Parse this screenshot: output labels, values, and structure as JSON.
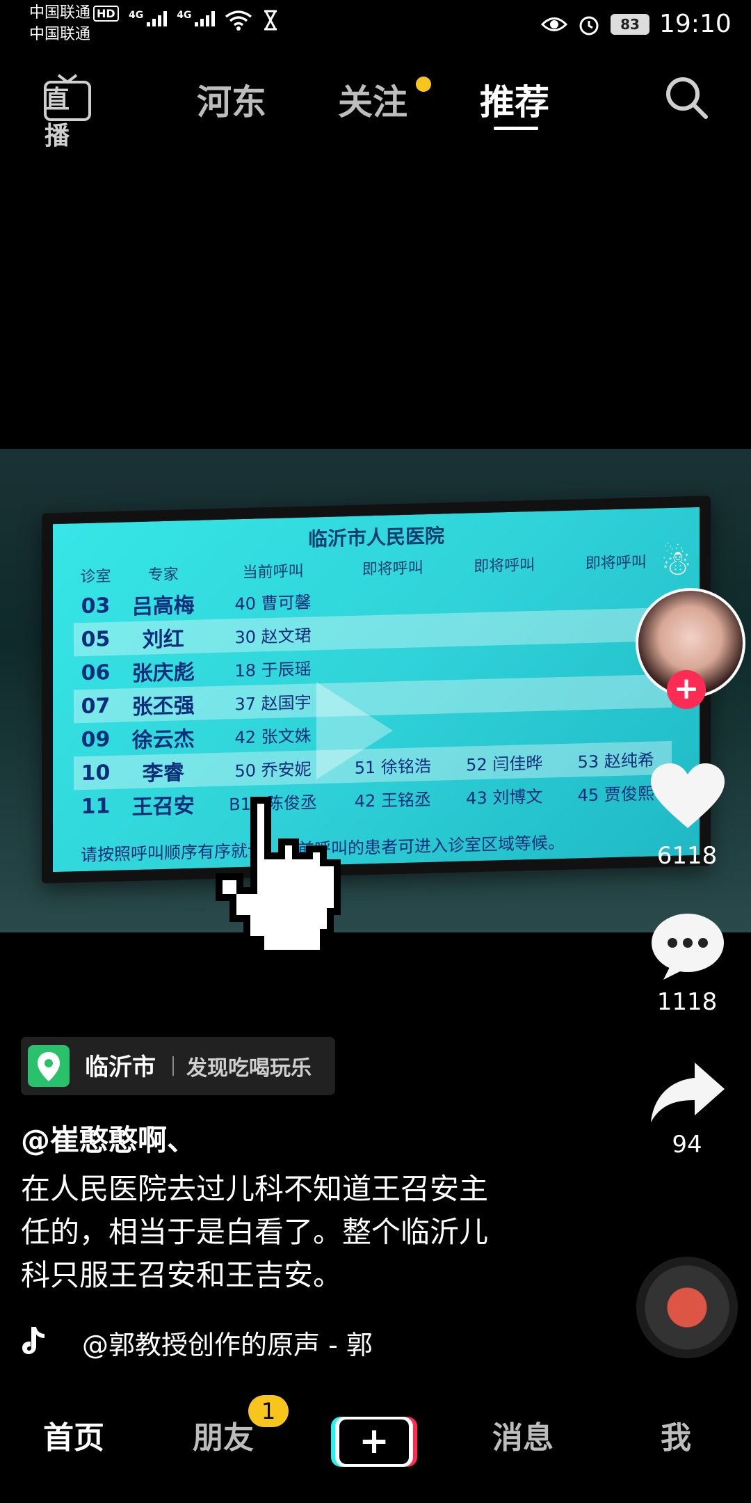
{
  "status_bar": {
    "carrier1": "中国联通",
    "carrier2": "中国联通",
    "hd": "HD",
    "net1": "4G",
    "net2": "4G",
    "battery": "83",
    "time": "19:10"
  },
  "top_nav": {
    "live": "直播",
    "tabs": [
      "河东",
      "关注",
      "推荐"
    ],
    "active_tab": "推荐"
  },
  "video": {
    "hospital_title": "临沂市人民医院",
    "headers": [
      "诊室",
      "专家",
      "当前呼叫",
      "即将呼叫",
      "即将呼叫",
      "即将呼叫"
    ],
    "rows": [
      [
        "03",
        "吕高梅",
        "40 曹可馨",
        "",
        "",
        ""
      ],
      [
        "05",
        "刘红",
        "30 赵文珺",
        "",
        "",
        ""
      ],
      [
        "06",
        "张庆彪",
        "18 于辰瑶",
        "",
        "",
        ""
      ],
      [
        "07",
        "张丕强",
        "37 赵国宇",
        "",
        "",
        ""
      ],
      [
        "09",
        "徐云杰",
        "42 张文姝",
        "",
        "",
        ""
      ],
      [
        "10",
        "李睿",
        "50 乔安妮",
        "51 徐铭浩",
        "52 闫佳晔",
        "53 赵纯希"
      ],
      [
        "11",
        "王召安",
        "B11 陈俊丞",
        "42 王铭丞",
        "43 刘博文",
        "45 贾俊熙"
      ]
    ],
    "notice": "请按照呼叫顺序有序就诊。当前呼叫的患者可进入诊室区域等候。"
  },
  "rail": {
    "likes": "6118",
    "comments": "1118",
    "shares": "94"
  },
  "location": {
    "city": "临沂市",
    "sub": "发现吃喝玩乐"
  },
  "post": {
    "author": "@崔憨憨啊、",
    "caption_lines": [
      "在人民医院去过儿科不知道王召安主",
      "任的，相当于是白看了。整个临沂儿",
      "科只服王召安和王吉安。"
    ],
    "music": "@郭教授创作的原声 - 郭"
  },
  "bottom_tabs": {
    "home": "首页",
    "friends": "朋友",
    "friends_badge": "1",
    "create": "+",
    "messages": "消息",
    "me": "我"
  }
}
